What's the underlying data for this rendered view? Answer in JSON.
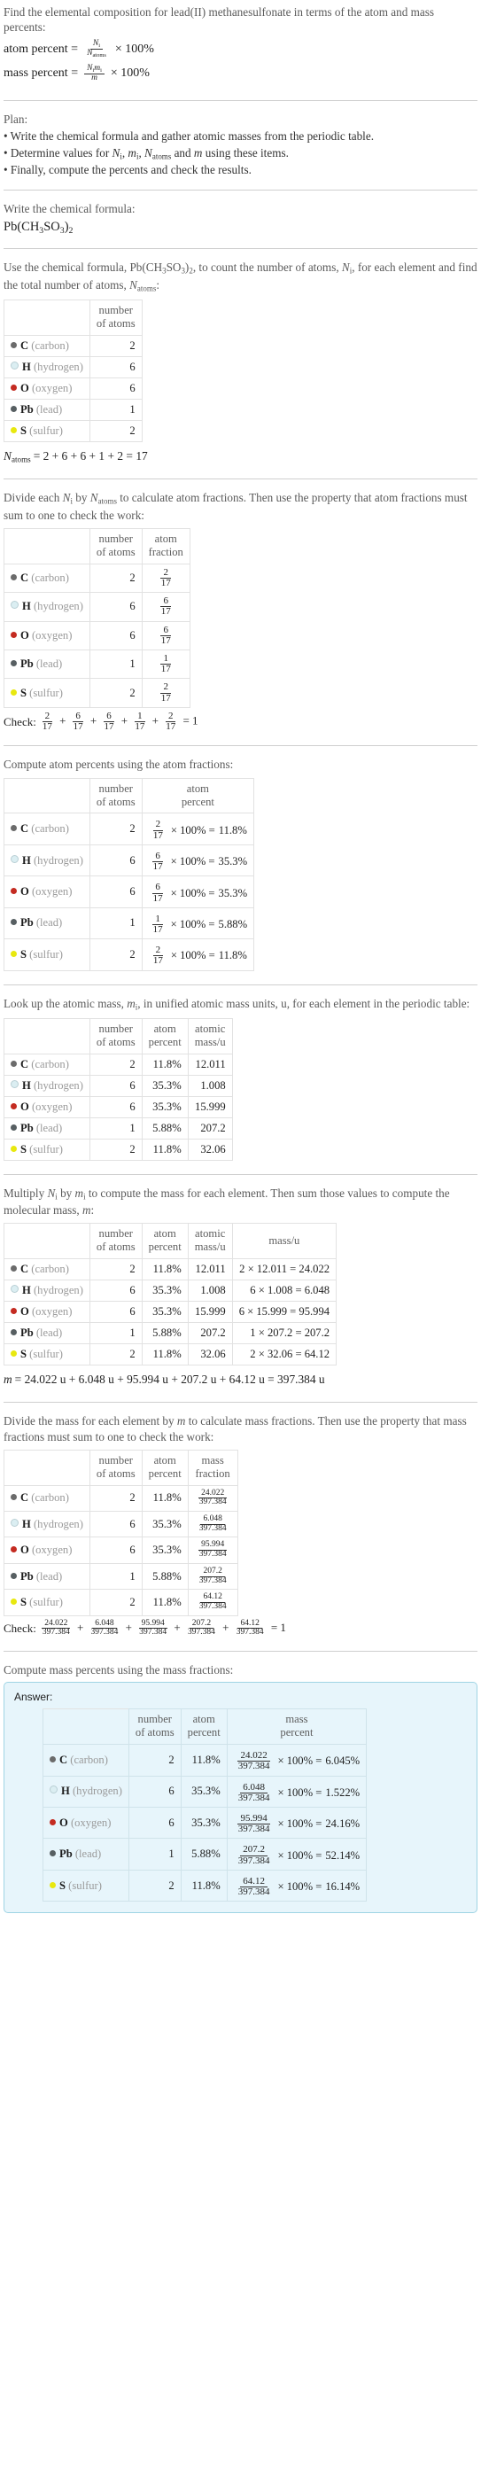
{
  "intro": {
    "question": "Find the elemental composition for lead(II) methanesulfonate in terms of the atom and mass percents:",
    "atom_percent_label": "atom percent =",
    "atom_percent_num": "N",
    "atom_percent_num_sub": "i",
    "atom_percent_den": "N",
    "atom_percent_den_sub": "atoms",
    "times_100": "× 100%",
    "mass_percent_label": "mass percent =",
    "mass_percent_num": "N",
    "mass_percent_num_sub": "i",
    "mass_percent_num2": "m",
    "mass_percent_num2_sub": "i",
    "mass_percent_den": "m"
  },
  "plan": {
    "title": "Plan:",
    "bullets": [
      "• Write the chemical formula and gather atomic masses from the periodic table.",
      "• Determine values for Ni, mi, Natoms and m using these items.",
      "• Finally, compute the percents and check the results."
    ],
    "bullet2_parts": {
      "lead": "• Determine values for ",
      "n": "N",
      "n_sub": "i",
      "sep1": ", ",
      "m": "m",
      "m_sub": "i",
      "sep2": ", ",
      "natoms": "N",
      "natoms_sub": "atoms",
      "mid": " and ",
      "mm": "m",
      "tail": " using these items."
    }
  },
  "formula_section": {
    "prompt": "Write the chemical formula:",
    "formula_plain": "Pb(CH3SO3)2",
    "formula_parts": [
      {
        "t": "Pb(CH",
        "sub": false
      },
      {
        "t": "3",
        "sub": true
      },
      {
        "t": "SO",
        "sub": false
      },
      {
        "t": "3",
        "sub": true
      },
      {
        "t": ")",
        "sub": false
      },
      {
        "t": "2",
        "sub": true
      }
    ]
  },
  "count_section": {
    "prompt_a": "Use the chemical formula, ",
    "prompt_formula": "Pb(CH3SO3)2",
    "prompt_b": ", to count the number of atoms, ",
    "prompt_ni": "Ni",
    "prompt_c": ", for each element and find the total number of atoms, ",
    "prompt_natoms": "Natoms",
    "prompt_d": ":",
    "headers": [
      "",
      "number of atoms"
    ],
    "header_lines": [
      [
        "number",
        "of atoms"
      ]
    ],
    "total_line": "Natoms = 2 + 6 + 6 + 1 + 2 = 17",
    "total_label": "N",
    "total_label_sub": "atoms",
    "total_expr": "= 2 + 6 + 6 + 1 + 2 = 17"
  },
  "fraction_section": {
    "prompt": "Divide each Ni by Natoms to calculate atom fractions. Then use the property that atom fractions must sum to one to check the work:",
    "prompt_p1": "Divide each ",
    "prompt_ni": "N",
    "prompt_ni_sub": "i",
    "prompt_p2": " by ",
    "prompt_natoms": "N",
    "prompt_natoms_sub": "atoms",
    "prompt_p3": " to calculate atom fractions. Then use the property that atom fractions must sum to one to check the work:",
    "headers": [
      [
        "number",
        "of atoms"
      ],
      [
        "atom",
        "fraction"
      ]
    ],
    "check_label": "Check:",
    "check_fracs": [
      {
        "num": "2",
        "den": "17"
      },
      {
        "num": "6",
        "den": "17"
      },
      {
        "num": "6",
        "den": "17"
      },
      {
        "num": "1",
        "den": "17"
      },
      {
        "num": "2",
        "den": "17"
      }
    ],
    "check_result": "= 1"
  },
  "atom_percent_section": {
    "prompt": "Compute atom percents using the atom fractions:",
    "headers": [
      [
        "number",
        "of atoms"
      ],
      [
        "atom",
        "percent"
      ]
    ]
  },
  "atomic_mass_section": {
    "prompt_p1": "Look up the atomic mass, ",
    "prompt_mi": "m",
    "prompt_mi_sub": "i",
    "prompt_p2": ", in unified atomic mass units, u, for each element in the periodic table:",
    "headers": [
      [
        "number",
        "of atoms"
      ],
      [
        "atom",
        "percent"
      ],
      [
        "atomic",
        "mass/u"
      ]
    ]
  },
  "mass_section": {
    "prompt_p1": "Multiply ",
    "prompt_ni": "N",
    "prompt_ni_sub": "i",
    "prompt_p2": " by ",
    "prompt_mi": "m",
    "prompt_mi_sub": "i",
    "prompt_p3": " to compute the mass for each element. Then sum those values to compute the molecular mass, ",
    "prompt_m": "m",
    "prompt_p4": ":",
    "headers": [
      [
        "number",
        "of atoms"
      ],
      [
        "atom",
        "percent"
      ],
      [
        "atomic",
        "mass/u"
      ],
      [
        "mass/u",
        ""
      ]
    ],
    "total_label": "m",
    "total_expr": "= 24.022 u + 6.048 u + 95.994 u + 207.2 u + 64.12 u = 397.384 u"
  },
  "mass_fraction_section": {
    "prompt": "Divide the mass for each element by m to calculate mass fractions. Then use the property that mass fractions must sum to one to check the work:",
    "prompt_p1": "Divide the mass for each element by ",
    "prompt_m": "m",
    "prompt_p2": " to calculate mass fractions. Then use the property that mass fractions must sum to one to check the work:",
    "headers": [
      [
        "number",
        "of atoms"
      ],
      [
        "atom",
        "percent"
      ],
      [
        "mass",
        "fraction"
      ]
    ],
    "check_label": "Check:",
    "check_fracs": [
      {
        "num": "24.022",
        "den": "397.384"
      },
      {
        "num": "6.048",
        "den": "397.384"
      },
      {
        "num": "95.994",
        "den": "397.384"
      },
      {
        "num": "207.2",
        "den": "397.384"
      },
      {
        "num": "64.12",
        "den": "397.384"
      }
    ],
    "check_result": "= 1"
  },
  "answer_section": {
    "prompt": "Compute mass percents using the mass fractions:",
    "answer_label": "Answer:",
    "headers": [
      [
        "number",
        "of atoms"
      ],
      [
        "atom",
        "percent"
      ],
      [
        "mass",
        "percent"
      ]
    ],
    "accent_border": "#9fd4e4",
    "accent_bg": "#e7f5fb"
  },
  "elements": [
    {
      "symbol": "C",
      "name": "(carbon)",
      "color": "#6b6b6b",
      "hollow": false,
      "count": "2",
      "frac_num": "2",
      "frac_den": "17",
      "atom_percent": "11.8%",
      "atomic_mass": "12.011",
      "mass_expr": "2 × 12.011 = 24.022",
      "mass": "24.022",
      "mass_percent": "6.045%"
    },
    {
      "symbol": "H",
      "name": "(hydrogen)",
      "color": "#dbeef2",
      "hollow": true,
      "count": "6",
      "frac_num": "6",
      "frac_den": "17",
      "atom_percent": "35.3%",
      "atomic_mass": "1.008",
      "mass_expr": "6 × 1.008 = 6.048",
      "mass": "6.048",
      "mass_percent": "1.522%"
    },
    {
      "symbol": "O",
      "name": "(oxygen)",
      "color": "#c42b21",
      "hollow": false,
      "count": "6",
      "frac_num": "6",
      "frac_den": "17",
      "atom_percent": "35.3%",
      "atomic_mass": "15.999",
      "mass_expr": "6 × 15.999 = 95.994",
      "mass": "95.994",
      "mass_percent": "24.16%"
    },
    {
      "symbol": "Pb",
      "name": "(lead)",
      "color": "#575f62",
      "hollow": false,
      "count": "1",
      "frac_num": "1",
      "frac_den": "17",
      "atom_percent": "5.88%",
      "atomic_mass": "207.2",
      "mass_expr": "1 × 207.2 = 207.2",
      "mass": "207.2",
      "mass_percent": "52.14%"
    },
    {
      "symbol": "S",
      "name": "(sulfur)",
      "color": "#e8e80f",
      "hollow": false,
      "count": "2",
      "frac_num": "2",
      "frac_den": "17",
      "atom_percent": "11.8%",
      "atomic_mass": "32.06",
      "mass_expr": "2 × 32.06 = 64.12",
      "mass": "64.12",
      "mass_percent": "16.14%"
    }
  ],
  "common": {
    "total_denominator": "397.384",
    "atoms_denominator": "17",
    "times_100_eq": "× 100% =",
    "times_sign": "×",
    "plus": "+",
    "equals": "=",
    "one": "1"
  }
}
